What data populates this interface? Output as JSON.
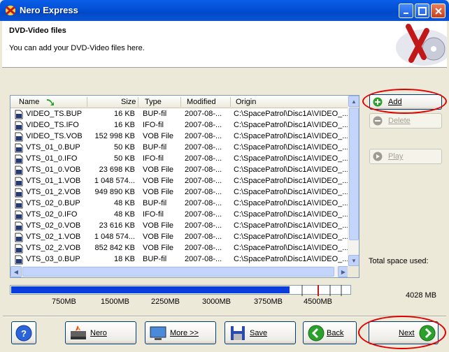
{
  "window": {
    "title": "Nero Express",
    "header_title": "DVD-Video files",
    "header_subtitle": "You can add your DVD-Video files here."
  },
  "filelist": {
    "columns": [
      "Name",
      "Size",
      "Type",
      "Modified",
      "Origin"
    ],
    "rows": [
      {
        "name": "VIDEO_TS.BUP",
        "size": "16 KB",
        "type": "BUP-fil",
        "modified": "2007-08-...",
        "origin": "C:\\SpacePatrol\\Disc1A\\VIDEO_..."
      },
      {
        "name": "VIDEO_TS.IFO",
        "size": "16 KB",
        "type": "IFO-fil",
        "modified": "2007-08-...",
        "origin": "C:\\SpacePatrol\\Disc1A\\VIDEO_..."
      },
      {
        "name": "VIDEO_TS.VOB",
        "size": "152 998 KB",
        "type": "VOB File",
        "modified": "2007-08-...",
        "origin": "C:\\SpacePatrol\\Disc1A\\VIDEO_..."
      },
      {
        "name": "VTS_01_0.BUP",
        "size": "50 KB",
        "type": "BUP-fil",
        "modified": "2007-08-...",
        "origin": "C:\\SpacePatrol\\Disc1A\\VIDEO_..."
      },
      {
        "name": "VTS_01_0.IFO",
        "size": "50 KB",
        "type": "IFO-fil",
        "modified": "2007-08-...",
        "origin": "C:\\SpacePatrol\\Disc1A\\VIDEO_..."
      },
      {
        "name": "VTS_01_0.VOB",
        "size": "23 698 KB",
        "type": "VOB File",
        "modified": "2007-08-...",
        "origin": "C:\\SpacePatrol\\Disc1A\\VIDEO_..."
      },
      {
        "name": "VTS_01_1.VOB",
        "size": "1 048 574...",
        "type": "VOB File",
        "modified": "2007-08-...",
        "origin": "C:\\SpacePatrol\\Disc1A\\VIDEO_..."
      },
      {
        "name": "VTS_01_2.VOB",
        "size": "949 890 KB",
        "type": "VOB File",
        "modified": "2007-08-...",
        "origin": "C:\\SpacePatrol\\Disc1A\\VIDEO_..."
      },
      {
        "name": "VTS_02_0.BUP",
        "size": "48 KB",
        "type": "BUP-fil",
        "modified": "2007-08-...",
        "origin": "C:\\SpacePatrol\\Disc1A\\VIDEO_..."
      },
      {
        "name": "VTS_02_0.IFO",
        "size": "48 KB",
        "type": "IFO-fil",
        "modified": "2007-08-...",
        "origin": "C:\\SpacePatrol\\Disc1A\\VIDEO_..."
      },
      {
        "name": "VTS_02_0.VOB",
        "size": "23 616 KB",
        "type": "VOB File",
        "modified": "2007-08-...",
        "origin": "C:\\SpacePatrol\\Disc1A\\VIDEO_..."
      },
      {
        "name": "VTS_02_1.VOB",
        "size": "1 048 574...",
        "type": "VOB File",
        "modified": "2007-08-...",
        "origin": "C:\\SpacePatrol\\Disc1A\\VIDEO_..."
      },
      {
        "name": "VTS_02_2.VOB",
        "size": "852 842 KB",
        "type": "VOB File",
        "modified": "2007-08-...",
        "origin": "C:\\SpacePatrol\\Disc1A\\VIDEO_..."
      },
      {
        "name": "VTS_03_0.BUP",
        "size": "18 KB",
        "type": "BUP-fil",
        "modified": "2007-08-...",
        "origin": "C:\\SpacePatrol\\Disc1A\\VIDEO_..."
      }
    ]
  },
  "side": {
    "add_label": "Add",
    "delete_label": "Delete",
    "play_label": "Play",
    "total_space_label": "Total space used:"
  },
  "capacity": {
    "ticks": [
      "750MB",
      "1500MB",
      "2250MB",
      "3000MB",
      "3750MB",
      "4500MB"
    ],
    "value": "4028 MB",
    "used_mb": 4028,
    "max_mb": 4900,
    "fill_color": "#0a3ddc"
  },
  "bottom": {
    "help_label": "?",
    "nero_label": "Nero",
    "more_label": "More >>",
    "save_label": "Save",
    "back_label": "Back",
    "next_label": "Next"
  },
  "colors": {
    "titlebar": "#0a5ee8",
    "annotation": "#e00000",
    "accent_green": "#2aa12a"
  }
}
